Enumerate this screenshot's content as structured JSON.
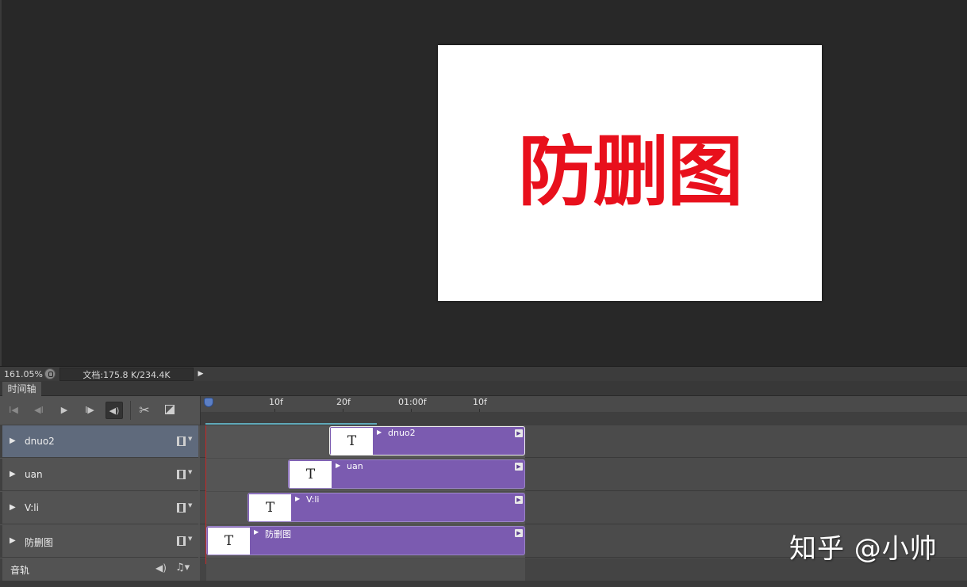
{
  "canvas": {
    "stamp_text": "防删图",
    "stamp_color": "#e8101c"
  },
  "status_bar": {
    "zoom": "161.05%",
    "doc_info": "文档:175.8 K/234.4K"
  },
  "timeline": {
    "tab_label": "时间轴",
    "ruler_labels": [
      "10f",
      "20f",
      "01:00f",
      "10f"
    ],
    "tracks": [
      {
        "name": "dnuo2",
        "clip_label": "dnuo2",
        "selected": true
      },
      {
        "name": "uan",
        "clip_label": "uan",
        "selected": false
      },
      {
        "name": "V:li",
        "clip_label": "V:li",
        "selected": false
      },
      {
        "name": "防删图",
        "clip_label": "防删图",
        "selected": false
      }
    ],
    "clip_thumb": "T",
    "audio_track_label": "音轨",
    "clip_color": "#7b5bb0"
  },
  "watermark": "知乎 @小帅"
}
